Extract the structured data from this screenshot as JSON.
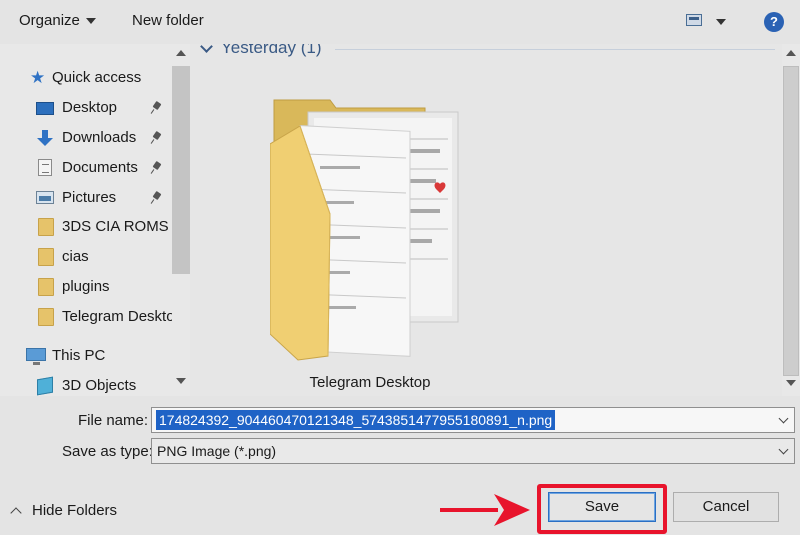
{
  "toolbar": {
    "organize_label": "Organize",
    "new_folder_label": "New folder",
    "help_label": "?"
  },
  "sidebar": {
    "items": [
      {
        "label": "Quick access",
        "icon": "star-icon"
      },
      {
        "label": "Desktop",
        "icon": "desktop-icon",
        "pinned": true
      },
      {
        "label": "Downloads",
        "icon": "download-icon",
        "pinned": true
      },
      {
        "label": "Documents",
        "icon": "documents-icon",
        "pinned": true
      },
      {
        "label": "Pictures",
        "icon": "pictures-icon",
        "pinned": true
      },
      {
        "label": "3DS CIA ROMS",
        "icon": "folder-icon"
      },
      {
        "label": "cias",
        "icon": "folder-icon"
      },
      {
        "label": "plugins",
        "icon": "folder-icon"
      },
      {
        "label": "Telegram Deskto",
        "icon": "folder-icon"
      },
      {
        "label": "This PC",
        "icon": "computer-icon"
      },
      {
        "label": "3D Objects",
        "icon": "3d-objects-icon"
      }
    ]
  },
  "main": {
    "group_title": "Yesterday (1)",
    "items": [
      {
        "name": "Telegram Desktop",
        "icon": "folder-icon"
      }
    ]
  },
  "form": {
    "file_name_label": "File name:",
    "file_name_value": "174824392_904460470121348_5743851477955180891_n.png",
    "save_type_label": "Save as type:",
    "save_type_value": "PNG Image (*.png)",
    "hide_folders_label": "Hide Folders",
    "save_label": "Save",
    "cancel_label": "Cancel"
  },
  "colors": {
    "selection": "#1f63c6",
    "highlight": "#e8142c",
    "group_title": "#3a5a85",
    "folder": "#e6c36a"
  }
}
